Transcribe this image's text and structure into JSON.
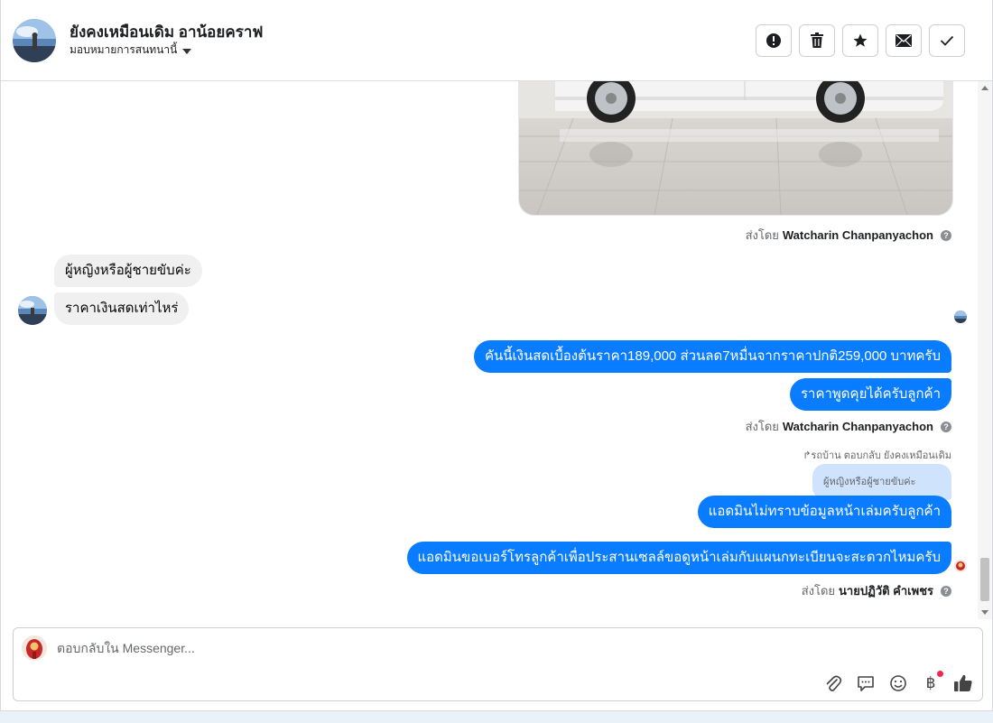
{
  "header": {
    "contact_name": "ยังคงเหมือนเดิม อาน้อยคราฟ",
    "assign_label": "มอบหมายการสนทนานี้",
    "actions": [
      {
        "name": "report-button",
        "icon": "alert-circle-icon"
      },
      {
        "name": "delete-button",
        "icon": "trash-icon"
      },
      {
        "name": "star-button",
        "icon": "star-icon"
      },
      {
        "name": "mark-unread-button",
        "icon": "envelope-icon"
      },
      {
        "name": "mark-done-button",
        "icon": "check-icon"
      }
    ]
  },
  "thread": {
    "attachment_image": "car-photo",
    "sent_by_1": {
      "prefix": "ส่งโดย",
      "name": "Watcharin Chanpanyachon"
    },
    "incoming": [
      "ผู้หญิงหรือผู้ชายขับค่ะ",
      "ราคาเงินสดเท่าไหร่"
    ],
    "outgoing_1": [
      "คันนี้เงินสดเบื้องต้นราคา189,000 ส่วนลด7หมื่นจากราคาปกติ259,000 บาทครับ",
      "ราคาพูดคุยได้ครับลูกค้า"
    ],
    "sent_by_2": {
      "prefix": "ส่งโดย",
      "name": "Watcharin Chanpanyachon"
    },
    "reply_meta": "รถบ้าน ตอบกลับ ยังคงเหมือนเดิม",
    "quoted_text": "ผู้หญิงหรือผู้ชายขับค่ะ",
    "outgoing_2": [
      "แอดมินไม่ทราบข้อมูลหน้าเล่มครับลูกค้า",
      "แอดมินขอเบอร์โทรลูกค้าเพื่อประสานเซลล์ขอดูหน้าเล่มกับแผนกทะเบียนจะสะดวกไหมครับ"
    ],
    "sent_by_3": {
      "prefix": "ส่งโดย",
      "name": "นายปฏิวัติ คำเพชร"
    }
  },
  "composer": {
    "placeholder": "ตอบกลับใน Messenger...",
    "tools": [
      "paperclip-icon",
      "saved-replies-icon",
      "emoji-icon",
      "baht-payment-icon",
      "thumbs-up-icon"
    ],
    "accent_color": "#0a7cff",
    "notification_color": "#f02849"
  }
}
